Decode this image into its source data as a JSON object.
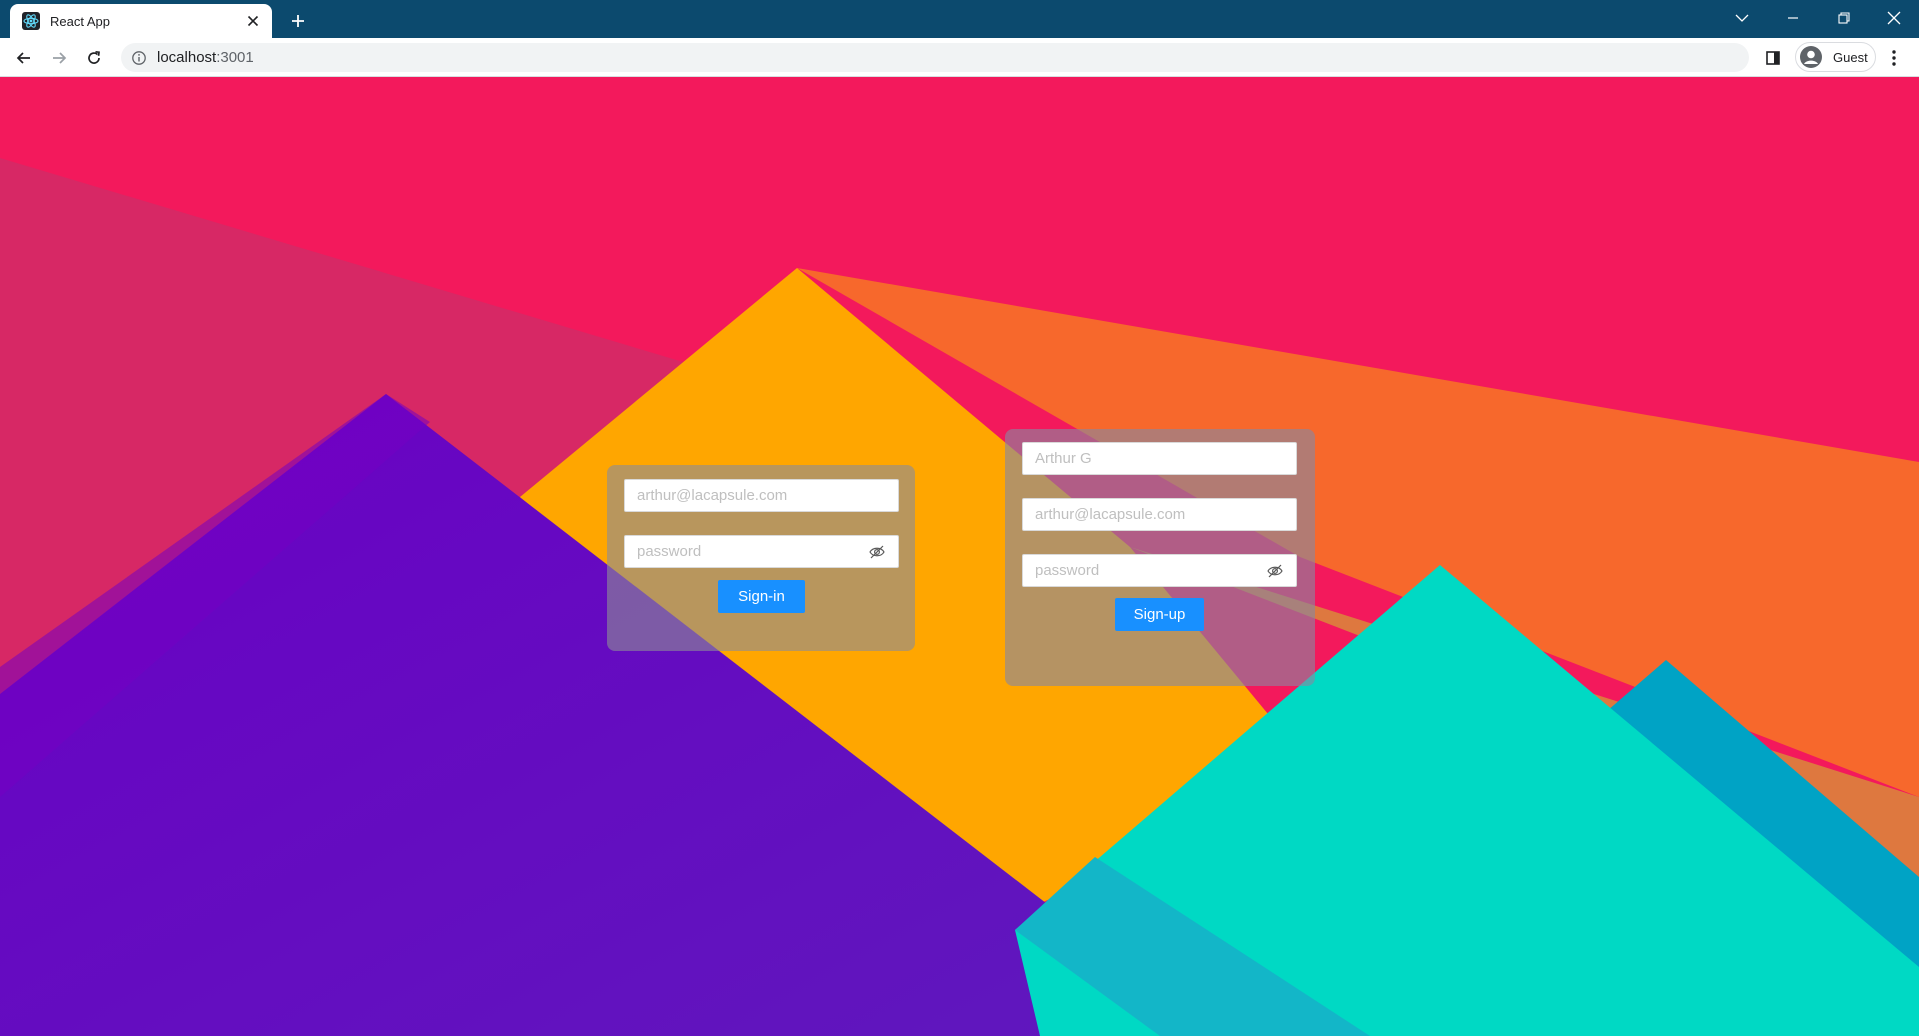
{
  "browser": {
    "tab_title": "React App",
    "url_host": "localhost",
    "url_port": ":3001",
    "profile_label": "Guest"
  },
  "signin": {
    "email_placeholder": "arthur@lacapsule.com",
    "password_placeholder": "password",
    "button_label": "Sign-in"
  },
  "signup": {
    "name_placeholder": "Arthur G",
    "email_placeholder": "arthur@lacapsule.com",
    "password_placeholder": "password",
    "button_label": "Sign-up"
  },
  "colors": {
    "background": "#f3195c",
    "button": "#1890ff",
    "titlebar": "#0c4a6e"
  },
  "icons": [
    "react-favicon",
    "close-icon",
    "plus-icon",
    "chevron-down-icon",
    "minimize-icon",
    "restore-icon",
    "back-arrow-icon",
    "forward-arrow-icon",
    "reload-icon",
    "info-icon",
    "side-panel-icon",
    "avatar-icon",
    "kebab-menu-icon",
    "eye-invisible-icon"
  ]
}
